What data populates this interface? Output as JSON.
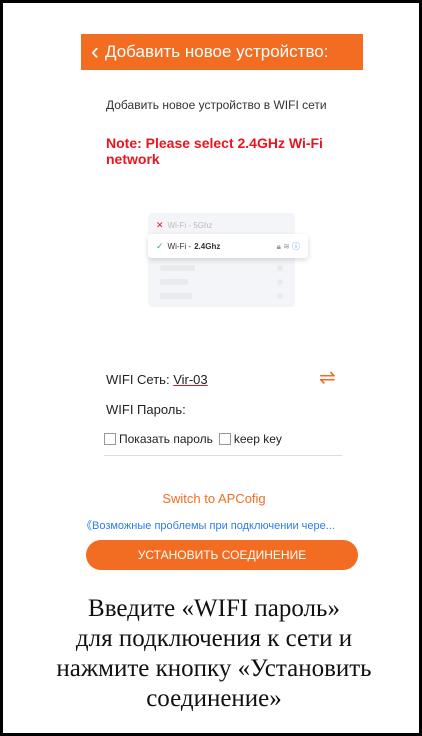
{
  "header": {
    "back_icon": "chevron-left-icon",
    "title": "Добавить новое устройство:"
  },
  "subtitle": "Добавить новое устройство в WIFI сети",
  "note": "Note: Please select 2.4GHz Wi-Fi network",
  "wifi_illustration": {
    "row_5g": {
      "name": "Wi-Fi",
      "band": "5Ghz"
    },
    "row_24": {
      "name": "Wi-Fi",
      "band": "2.4Ghz"
    }
  },
  "wifi_network": {
    "label": "WIFI Сеть:",
    "value": "Vir-03"
  },
  "wifi_password": {
    "label": "WIFI Пароль:"
  },
  "options": {
    "show_password": "Показать пароль",
    "keep_key": "keep key"
  },
  "switch_ap": "Switch to APCofig",
  "problems_link": "《Возможные проблемы при подключении чере...",
  "connect_button": "УСТАНОВИТЬ СОЕДИНЕНИЕ",
  "caption": {
    "line1": "Введите «WIFI пароль»",
    "line2": "для подключения к сети и",
    "line3": "нажмите кнопку «Установить",
    "line4": "соединение»"
  },
  "colors": {
    "accent": "#f26d21",
    "note": "#e8151f",
    "link": "#2b7de9"
  }
}
